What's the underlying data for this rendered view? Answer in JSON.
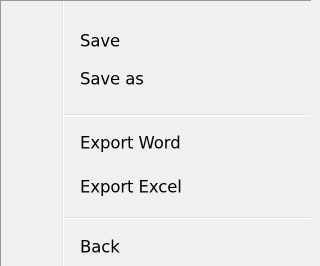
{
  "context_menu": {
    "items": [
      {
        "label": "Save"
      },
      {
        "label": "Save as"
      },
      {
        "label": "Export Word"
      },
      {
        "label": "Export Excel"
      },
      {
        "label": "Back"
      }
    ]
  },
  "colors": {
    "menu_background": "#f0f0f0",
    "border": "#979797",
    "separator": "#e0e0e0",
    "text": "#000000"
  }
}
